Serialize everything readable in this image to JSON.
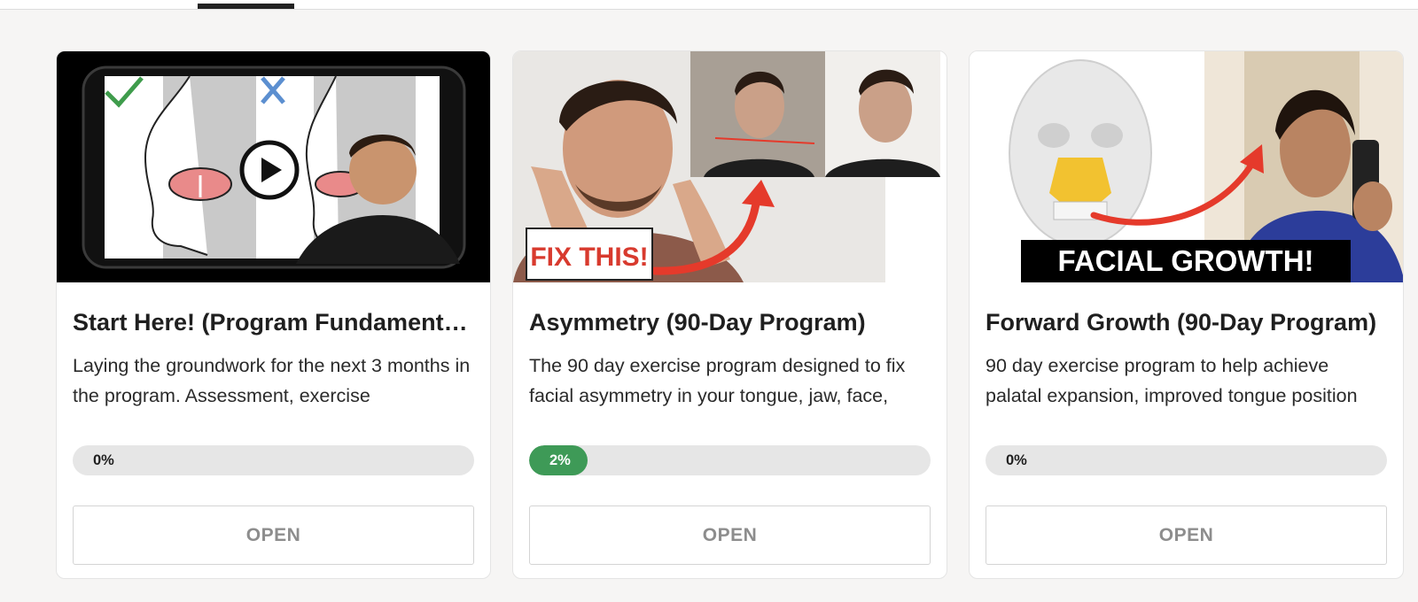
{
  "colors": {
    "progress_fill": "#3e9a57",
    "progress_track": "#e6e6e6",
    "button_text": "#8d8d8d",
    "arrow_red": "#e53a2b",
    "background": "#f6f5f4"
  },
  "cards": [
    {
      "title": "Start Here! (Program Fundamentals)",
      "description": "Laying the groundwork for the next 3 months in the program. Assessment, exercise",
      "progress_label": "0%",
      "progress": 0,
      "button_label": "OPEN",
      "thumbnail": {
        "icons": [
          "checkmark-icon",
          "x-mark-icon",
          "play-icon"
        ]
      }
    },
    {
      "title": "Asymmetry (90-Day Program)",
      "description": "The 90 day exercise program designed to fix facial asymmetry in your tongue, jaw, face,",
      "progress_label": "2%",
      "progress": 2,
      "button_label": "OPEN",
      "thumbnail": {
        "overlay_text": "FIX THIS!",
        "icons": [
          "red-arrow-icon"
        ]
      }
    },
    {
      "title": "Forward Growth (90-Day Program)",
      "description": "90 day exercise program to help achieve palatal expansion, improved tongue position",
      "progress_label": "0%",
      "progress": 0,
      "button_label": "OPEN",
      "thumbnail": {
        "overlay_text": "FACIAL GROWTH!",
        "icons": [
          "red-arrow-icon"
        ]
      }
    }
  ]
}
